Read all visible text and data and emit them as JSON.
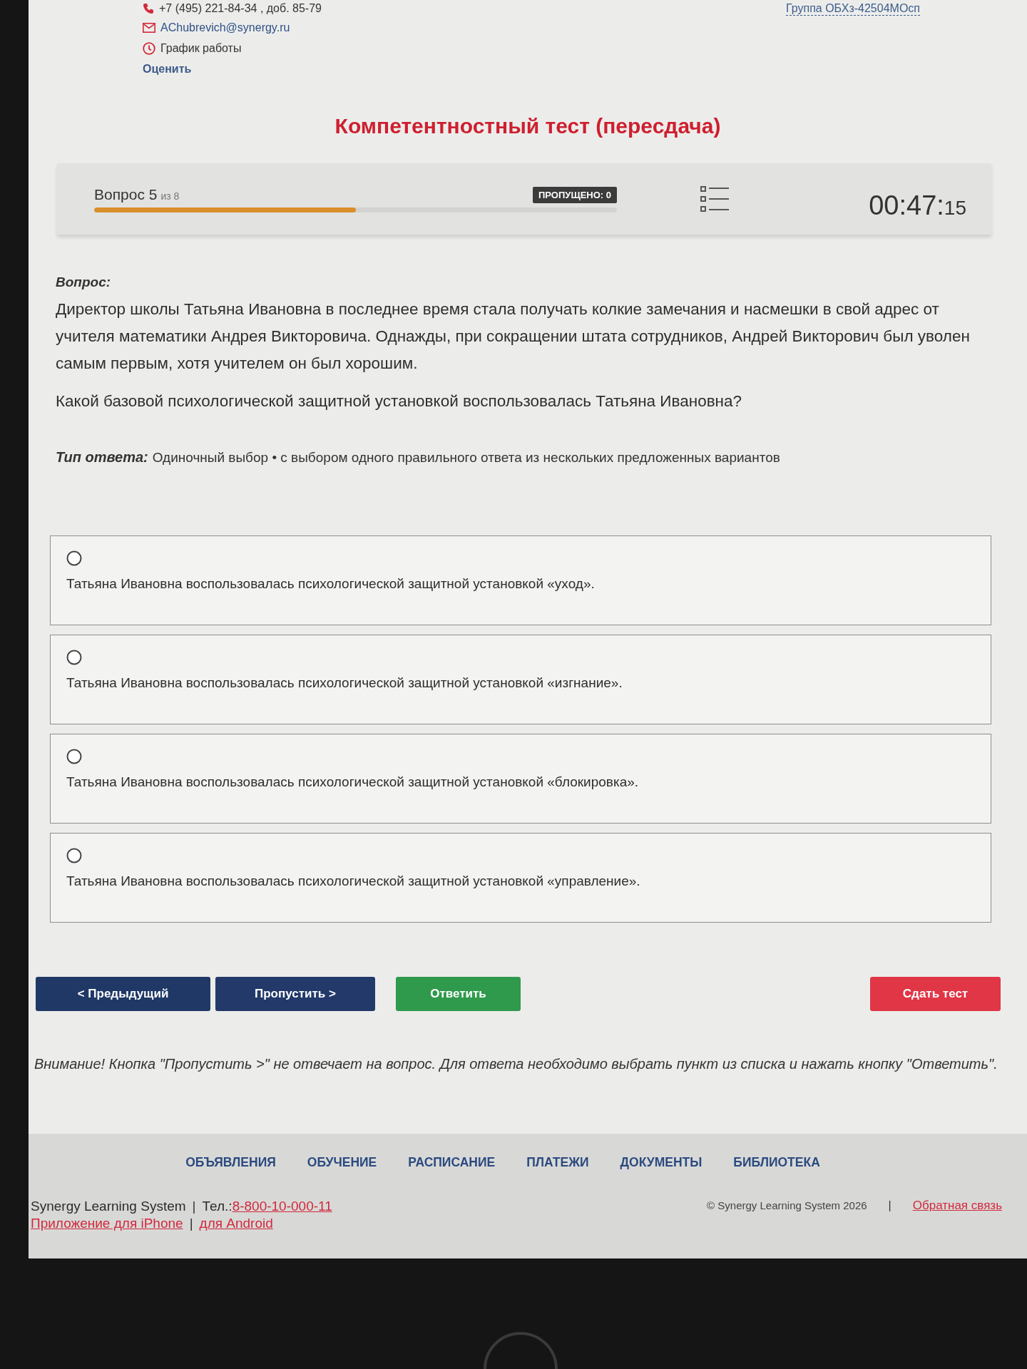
{
  "header": {
    "phone": "+7 (495) 221-84-34 , доб. 85-79",
    "group": "Группа ОБХз-42504МОсп",
    "email": "AChubrevich@synergy.ru",
    "schedule": "График работы",
    "rate": "Оценить"
  },
  "title": "Компетентностный тест (пересдача)",
  "progress": {
    "question": "Вопрос 5",
    "of_total": "из 8",
    "level": 0.5,
    "skipped": "ПРОПУЩЕНО: 0",
    "timer": {
      "main": "00:47:",
      "seconds": "15"
    }
  },
  "question": {
    "heading": "Вопрос:",
    "text": "Директор школы Татьяна Ивановна в последнее время стала получать колкие замечания и насмешки в свой адрес от учителя математики Андрея Викторовича. Однажды, при сокращении штата сотрудников, Андрей Викторович был уволен самым первым, хотя учителем он был хорошим.",
    "prompt": "Какой базовой психологической защитной установкой воспользовалась Татьяна Ивановна?",
    "answer_type_label": "Тип ответа:",
    "answer_type": "Одиночный выбор • с выбором одного правильного ответа из нескольких предложенных вариантов"
  },
  "options": [
    {
      "text": "Татьяна Ивановна воспользовалась психологической защитной установкой «уход».",
      "selected": false
    },
    {
      "text": "Татьяна Ивановна воспользовалась психологической защитной установкой «изгнание».",
      "selected": false
    },
    {
      "text": "Татьяна Ивановна воспользовалась психологической защитной установкой «блокировка».",
      "selected": false
    },
    {
      "text": "Татьяна Ивановна воспользовалась психологической защитной установкой «управление».",
      "selected": false
    }
  ],
  "buttons": [
    {
      "label": "< Предыдущий",
      "kind": "previous"
    },
    {
      "label": "Пропустить >",
      "kind": "skip"
    },
    {
      "label": "Ответить",
      "kind": "answer"
    },
    {
      "label": "Сдать тест",
      "kind": "submit"
    }
  ],
  "warning": "Внимание! Кнопка \"Пропустить >\" не отвечает на вопрос. Для ответа необходимо выбрать пункт из списка и нажать кнопку \"Ответить\".",
  "footer": {
    "nav": [
      "ОБЪЯВЛЕНИЯ",
      "ОБУЧЕНИЕ",
      "РАСПИСАНИЕ",
      "ПЛАТЕЖИ",
      "ДОКУМЕНТЫ",
      "БИБЛИОТЕКА"
    ],
    "contact_lines": [
      {
        "parts": [
          {
            "kind": "text",
            "text": "Synergy Learning System"
          },
          {
            "kind": "separator",
            "text": "|"
          },
          {
            "kind": "text",
            "text": "Тел.:"
          },
          {
            "kind": "link",
            "text": "8-800-10-000-11"
          }
        ]
      },
      {
        "parts": [
          {
            "kind": "link",
            "text": "Приложение для iPhone"
          },
          {
            "kind": "separator",
            "text": "|"
          },
          {
            "kind": "link",
            "text": "для Android"
          }
        ]
      }
    ],
    "legal_parts": [
      {
        "kind": "note",
        "text": "© Synergy Learning System 2026"
      },
      {
        "kind": "separator",
        "text": "|"
      },
      {
        "kind": "link",
        "text": "Обратная связь"
      }
    ]
  }
}
